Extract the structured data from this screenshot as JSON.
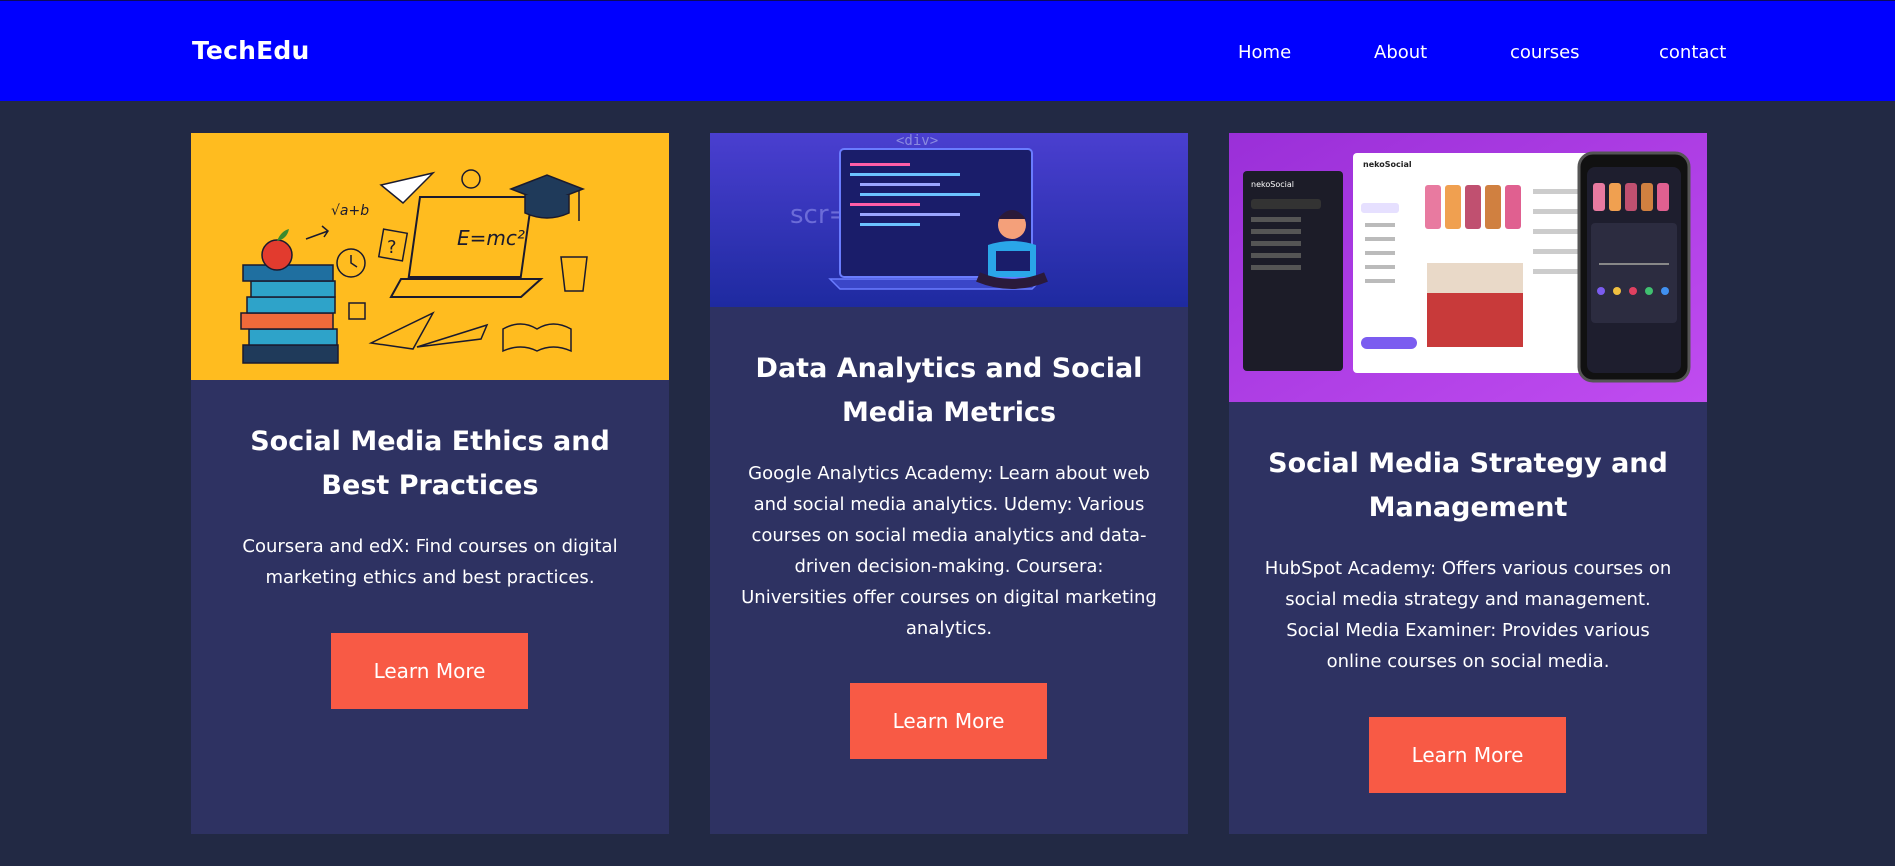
{
  "header": {
    "brand": "TechEdu",
    "nav": [
      {
        "label": "Home"
      },
      {
        "label": "About"
      },
      {
        "label": "courses"
      },
      {
        "label": "contact"
      }
    ]
  },
  "cards": [
    {
      "title": "Social Media Ethics and Best Practices",
      "description": "Coursera and edX: Find courses on digital marketing ethics and best practices.",
      "button": "Learn More",
      "image": {
        "text": "E=mc²",
        "formula": "√a+b",
        "icon": "education-illustration"
      }
    },
    {
      "title": "Data Analytics and Social Media Metrics",
      "description": "Google Analytics Academy: Learn about web and social media analytics. Udemy: Various courses on social media analytics and data-driven decision-making. Coursera: Universities offer courses on digital marketing analytics.",
      "button": "Learn More",
      "image": {
        "tag": "<div>",
        "code": "scr=",
        "icon": "laptop-coder-illustration"
      }
    },
    {
      "title": "Social Media Strategy and Management",
      "description": "HubSpot Academy: Offers various courses on social media strategy and management. Social Media Examiner: Provides various online courses on social media.",
      "button": "Learn More",
      "image": {
        "app_name": "nekoSocial",
        "icon": "social-app-mockup"
      }
    }
  ],
  "colors": {
    "nav_bg": "#0000FF",
    "page_bg": "#222944",
    "card_bg": "#2E3262",
    "button_bg": "#F85A45",
    "card1_image_bg": "#FFBC1F",
    "card2_image_bg": "#2B30B8",
    "card3_image_bg": "#A93BE6"
  }
}
